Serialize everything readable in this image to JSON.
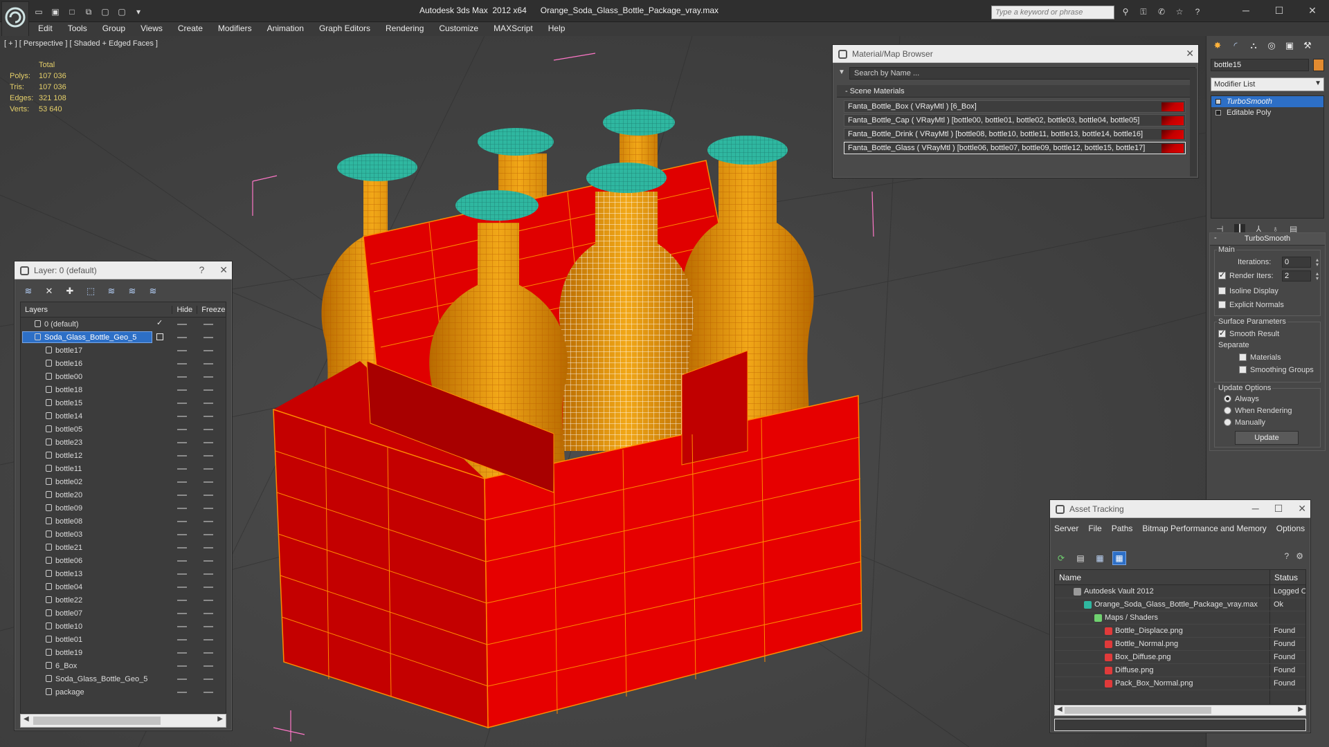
{
  "title": "Autodesk 3ds Max  2012 x64      Orange_Soda_Glass_Bottle_Package_vray.max",
  "search_placeholder": "Type a keyword or phrase",
  "menus": [
    "Edit",
    "Tools",
    "Group",
    "Views",
    "Create",
    "Modifiers",
    "Animation",
    "Graph Editors",
    "Rendering",
    "Customize",
    "MAXScript",
    "Help"
  ],
  "viewport": {
    "label": "[ + ] [ Perspective ] [ Shaded + Edged Faces ]",
    "stats_header": "Total",
    "stats": [
      {
        "k": "Polys:",
        "v": "107 036"
      },
      {
        "k": "Tris:",
        "v": "107 036"
      },
      {
        "k": "Edges:",
        "v": "321 108"
      },
      {
        "k": "Verts:",
        "v": "53 640"
      }
    ]
  },
  "layer_panel": {
    "title": "Layer: 0 (default)",
    "help": "?",
    "col_layers": "Layers",
    "col_hide": "Hide",
    "col_freeze": "Freeze",
    "rows": [
      {
        "name": "0 (default)",
        "indent": 0,
        "active": true
      },
      {
        "name": "Soda_Glass_Bottle_Geo_5",
        "indent": 0,
        "selected": true
      },
      {
        "name": "bottle17",
        "indent": 1
      },
      {
        "name": "bottle16",
        "indent": 1
      },
      {
        "name": "bottle00",
        "indent": 1
      },
      {
        "name": "bottle18",
        "indent": 1
      },
      {
        "name": "bottle15",
        "indent": 1
      },
      {
        "name": "bottle14",
        "indent": 1
      },
      {
        "name": "bottle05",
        "indent": 1
      },
      {
        "name": "bottle23",
        "indent": 1
      },
      {
        "name": "bottle12",
        "indent": 1
      },
      {
        "name": "bottle11",
        "indent": 1
      },
      {
        "name": "bottle02",
        "indent": 1
      },
      {
        "name": "bottle20",
        "indent": 1
      },
      {
        "name": "bottle09",
        "indent": 1
      },
      {
        "name": "bottle08",
        "indent": 1
      },
      {
        "name": "bottle03",
        "indent": 1
      },
      {
        "name": "bottle21",
        "indent": 1
      },
      {
        "name": "bottle06",
        "indent": 1
      },
      {
        "name": "bottle13",
        "indent": 1
      },
      {
        "name": "bottle04",
        "indent": 1
      },
      {
        "name": "bottle22",
        "indent": 1
      },
      {
        "name": "bottle07",
        "indent": 1
      },
      {
        "name": "bottle10",
        "indent": 1
      },
      {
        "name": "bottle01",
        "indent": 1
      },
      {
        "name": "bottle19",
        "indent": 1
      },
      {
        "name": "6_Box",
        "indent": 1
      },
      {
        "name": "Soda_Glass_Bottle_Geo_5",
        "indent": 1
      },
      {
        "name": "package",
        "indent": 1
      }
    ]
  },
  "material_browser": {
    "title": "Material/Map Browser",
    "search_placeholder": "Search by Name ...",
    "section": "- Scene Materials",
    "materials": [
      "Fanta_Bottle_Box  ( VRayMtl )  [6_Box]",
      "Fanta_Bottle_Cap  ( VRayMtl )  [bottle00, bottle01, bottle02, bottle03, bottle04, bottle05]",
      "Fanta_Bottle_Drink  ( VRayMtl )  [bottle08, bottle10, bottle11, bottle13, bottle14, bottle16]",
      "Fanta_Bottle_Glass  ( VRayMtl )  [bottle06, bottle07, bottle09, bottle12, bottle15, bottle17]"
    ],
    "selected_index": 3
  },
  "command_panel": {
    "object_name": "bottle15",
    "modifier_list": "Modifier List",
    "stack": [
      "TurboSmooth",
      "Editable Poly"
    ],
    "turbosmooth": {
      "title": "TurboSmooth",
      "main": "Main",
      "iterations_label": "Iterations:",
      "iterations": "0",
      "render_iters_label": "Render Iters:",
      "render_iters": "2",
      "isoline": "Isoline Display",
      "explicit": "Explicit Normals",
      "surface": "Surface Parameters",
      "smooth_result": "Smooth Result",
      "separate": "Separate",
      "materials": "Materials",
      "smoothing_groups": "Smoothing Groups",
      "update_options": "Update Options",
      "always": "Always",
      "when_rendering": "When Rendering",
      "manually": "Manually",
      "update": "Update"
    }
  },
  "asset_tracking": {
    "title": "Asset Tracking",
    "menus": [
      "Server",
      "File",
      "Paths",
      "Bitmap Performance and Memory",
      "Options"
    ],
    "col_name": "Name",
    "col_status": "Status",
    "rows": [
      {
        "name": "Autodesk Vault 2012",
        "status": "Logged Out",
        "indent": 1,
        "icon": "vault-icon"
      },
      {
        "name": "Orange_Soda_Glass_Bottle_Package_vray.max",
        "status": "Ok",
        "indent": 2,
        "icon": "max-file-icon"
      },
      {
        "name": "Maps / Shaders",
        "status": "",
        "indent": 3,
        "icon": "maps-icon"
      },
      {
        "name": "Bottle_Displace.png",
        "status": "Found",
        "indent": 4,
        "icon": "png-icon"
      },
      {
        "name": "Bottle_Normal.png",
        "status": "Found",
        "indent": 4,
        "icon": "png-icon"
      },
      {
        "name": "Box_Diffuse.png",
        "status": "Found",
        "indent": 4,
        "icon": "png-icon"
      },
      {
        "name": "Diffuse.png",
        "status": "Found",
        "indent": 4,
        "icon": "png-icon"
      },
      {
        "name": "Pack_Box_Normal.png",
        "status": "Found",
        "indent": 4,
        "icon": "png-icon"
      }
    ]
  },
  "colors": {
    "box_red": "#e00000",
    "bottle_orange": "#d88a10",
    "cap_teal": "#2fb7a0",
    "selection_blue": "#2d6fc6"
  }
}
